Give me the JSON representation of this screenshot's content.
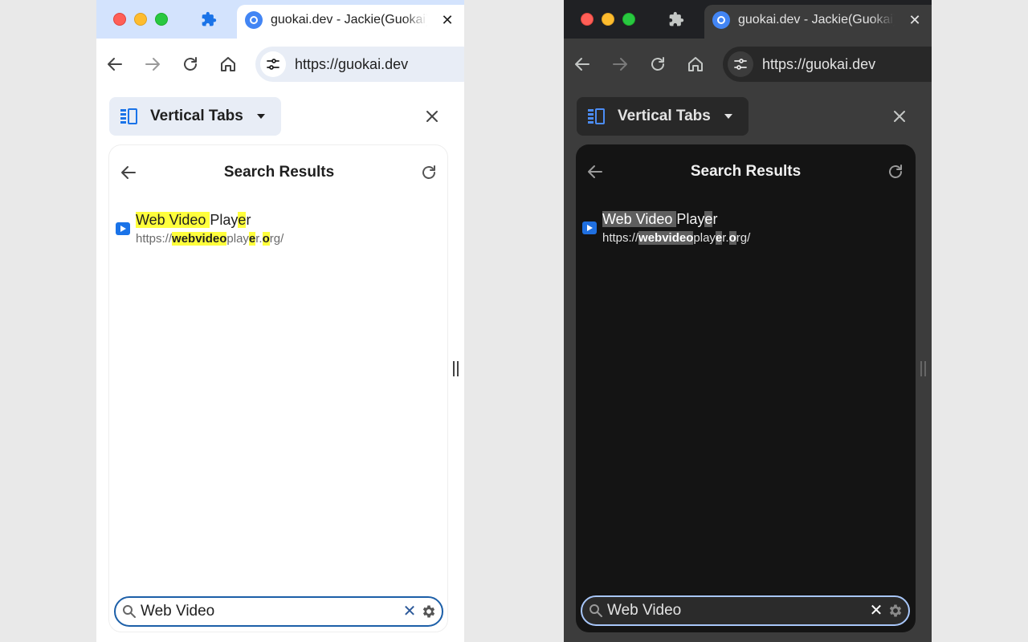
{
  "browser": {
    "tab_title": "guokai.dev - Jackie(Guokai) Han",
    "tab_close": "✕",
    "url": "https://guokai.dev"
  },
  "side_panel": {
    "selector_label": "Vertical Tabs",
    "close": "✕"
  },
  "search_view": {
    "title": "Search Results",
    "results": [
      {
        "title_parts": [
          {
            "text": "Web Video ",
            "highlight": true
          },
          {
            "text": "Play",
            "highlight": false
          },
          {
            "text": "e",
            "highlight": true
          },
          {
            "text": "r",
            "highlight": false
          }
        ],
        "url_parts": [
          {
            "text": "https://",
            "highlight": false
          },
          {
            "text": "webvideo",
            "highlight": true
          },
          {
            "text": "play",
            "highlight": false
          },
          {
            "text": "e",
            "highlight": true
          },
          {
            "text": "r.",
            "highlight": false
          },
          {
            "text": "o",
            "highlight": true
          },
          {
            "text": "rg/",
            "highlight": false
          }
        ]
      }
    ],
    "search_value": "Web Video",
    "clear": "✕"
  },
  "themes": {
    "light": {
      "highlight": "#ffff3c",
      "search_border": "#1c5fa8"
    },
    "dark": {
      "highlight": "#5f5f5f",
      "search_border": "#a8c7fa"
    }
  },
  "icons": [
    "puzzle-icon",
    "back-icon",
    "forward-icon",
    "reload-icon",
    "home-icon",
    "site-settings-icon",
    "vertical-tabs-icon",
    "caret-down-icon",
    "close-icon",
    "video-favicon",
    "search-icon",
    "gear-icon"
  ]
}
